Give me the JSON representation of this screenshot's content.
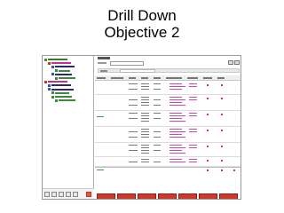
{
  "slide": {
    "title_line1": "Drill Down",
    "title_line2": "Objective 2"
  },
  "tree": {
    "items": [
      {
        "level": 0,
        "icon_color": "#4a8a3a",
        "label_color": "#3a7a2a"
      },
      {
        "level": 1,
        "icon_color": "#cc3333",
        "label_color": "#c52f8e"
      },
      {
        "level": 2,
        "icon_color": "#3355aa",
        "label_color": "#2a2a6a"
      },
      {
        "level": 3,
        "icon_color": "#3c8a3c",
        "label_color": "#3c8a3c"
      },
      {
        "level": 2,
        "icon_color": "#3355aa",
        "label_color": "#2a2a6a"
      },
      {
        "level": 3,
        "icon_color": "#3c8a3c",
        "label_color": "#3c8a3c"
      },
      {
        "level": 0,
        "icon_color": "#cc3333",
        "label_color": "#c52f8e"
      },
      {
        "level": 1,
        "icon_color": "#3355aa",
        "label_color": "#2a2a6a"
      },
      {
        "level": 1,
        "icon_color": "#3355aa",
        "label_color": "#2a2a6a"
      },
      {
        "level": 2,
        "icon_color": "#3c8a3c",
        "label_color": "#3c8a3c"
      },
      {
        "level": 2,
        "icon_color": "#3c8a3c",
        "label_color": "#3c8a3c"
      },
      {
        "level": 3,
        "icon_color": "#3c8a3c",
        "label_color": "#3c8a3c"
      }
    ]
  },
  "toolbar_buttons": [
    "first",
    "prev",
    "refresh",
    "next",
    "last",
    "export"
  ],
  "grid": {
    "columns": 9,
    "rows": [
      {
        "kind": "header-row"
      },
      {
        "kind": "data",
        "accent": "pink"
      },
      {
        "kind": "data",
        "accent": "pink"
      },
      {
        "kind": "data",
        "accent": "pink"
      },
      {
        "kind": "data",
        "accent": "pink"
      },
      {
        "kind": "data",
        "accent": "pink"
      }
    ]
  },
  "action_buttons": [
    {
      "label": ""
    },
    {
      "label": ""
    },
    {
      "label": ""
    },
    {
      "label": ""
    },
    {
      "label": ""
    },
    {
      "label": ""
    },
    {
      "label": ""
    }
  ],
  "colors": {
    "accent_red": "#cc3a2e",
    "link_pink": "#c94aa0",
    "tree_green": "#3e9b3e"
  }
}
